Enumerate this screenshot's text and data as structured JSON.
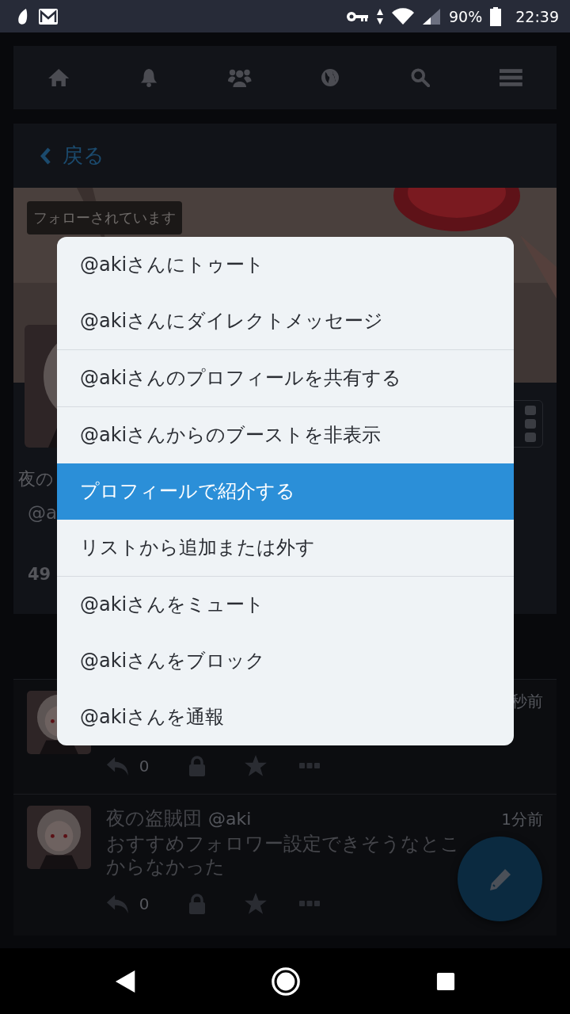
{
  "status_bar": {
    "battery": "90%",
    "time": "22:39"
  },
  "profile": {
    "back": "戻る",
    "followed_badge": "フォローされています",
    "name": "夜の",
    "handle": "@a",
    "stat": "49"
  },
  "posts": [
    {
      "time": "秒前",
      "reply_count": "0"
    },
    {
      "name": "夜の盗賊団",
      "handle": "@aki",
      "time": "1分前",
      "text_lines": [
        "おすすめフォロワー設定できそうなとこ",
        "からなかった"
      ],
      "reply_count": "0"
    }
  ],
  "menu": {
    "groups": [
      [
        {
          "label": "@akiさんにトゥート",
          "selected": false
        },
        {
          "label": "@akiさんにダイレクトメッセージ",
          "selected": false
        }
      ],
      [
        {
          "label": "@akiさんのプロフィールを共有する",
          "selected": false
        }
      ],
      [
        {
          "label": "@akiさんからのブーストを非表示",
          "selected": false
        },
        {
          "label": "プロフィールで紹介する",
          "selected": true
        },
        {
          "label": "リストから追加または外す",
          "selected": false
        }
      ],
      [
        {
          "label": "@akiさんをミュート",
          "selected": false
        },
        {
          "label": "@akiさんをブロック",
          "selected": false
        },
        {
          "label": "@akiさんを通報",
          "selected": false
        }
      ]
    ]
  }
}
